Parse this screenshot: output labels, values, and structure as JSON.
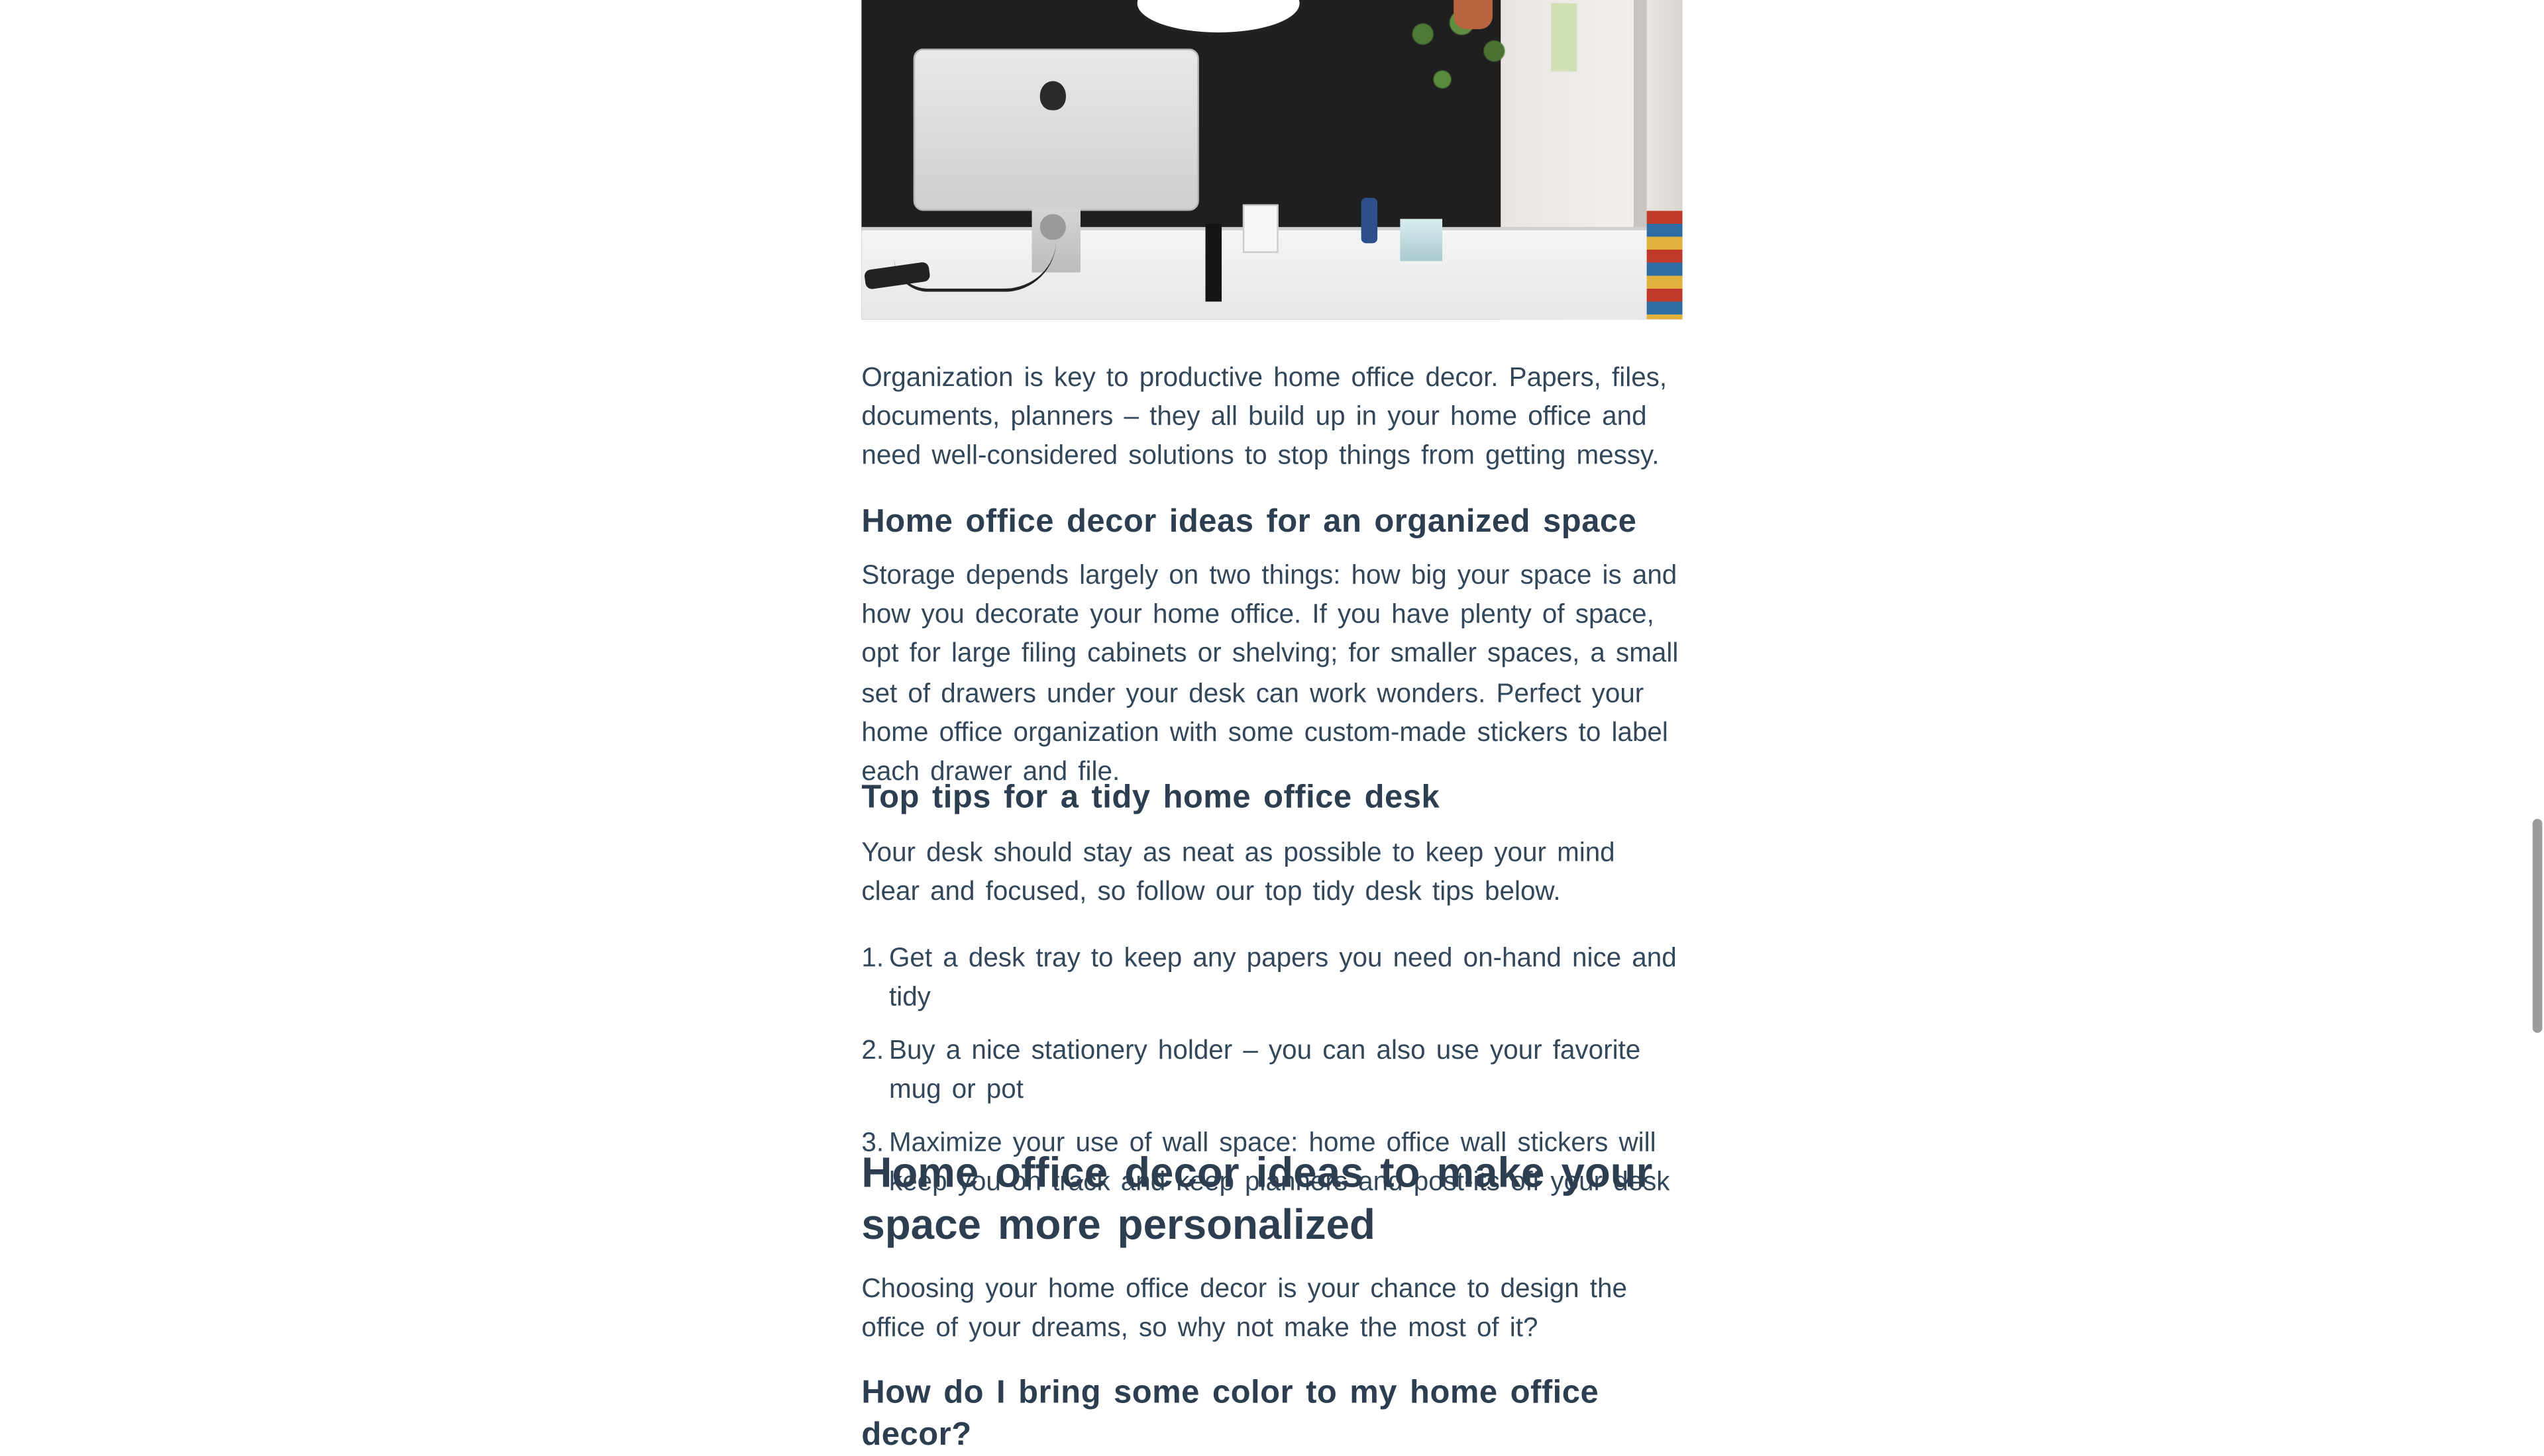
{
  "hero_image": {
    "alt": "home office desk with computer and plant"
  },
  "paragraphs": {
    "intro": "Organization is key to productive home office decor. Papers, files, documents, planners – they all build up in your home office and need well-considered solutions to stop things from getting messy.",
    "storage": "Storage depends largely on two things: how big your space is and how you decorate your home office. If you have plenty of space, opt for large filing cabinets or shelving; for smaller spaces, a small set of drawers under your desk can work wonders. Perfect your home office organization with some custom-made stickers to label each drawer and file.",
    "tidy": "Your desk should stay as neat as possible to keep your mind clear and focused, so follow our top tidy desk tips below.",
    "personal": "Choosing your home office decor is your chance to design the office of your dreams, so why not make the most of it?"
  },
  "headings": {
    "organized": "Home office decor ideas for an organized space",
    "tidy_tips": "Top tips for a tidy home office desk",
    "personalized": "Home office decor ideas to make your space more personalized",
    "color": "How do I bring some color to my home office decor?"
  },
  "tips": [
    {
      "num": "1.",
      "text": "Get a desk tray to keep any papers you need on-hand nice and tidy"
    },
    {
      "num": "2.",
      "text": "Buy a nice stationery holder – you can also use your favorite mug or pot"
    },
    {
      "num": "3.",
      "text": "Maximize your use of wall space: home office wall stickers will keep you on track and keep planners and post-its off your desk"
    }
  ]
}
